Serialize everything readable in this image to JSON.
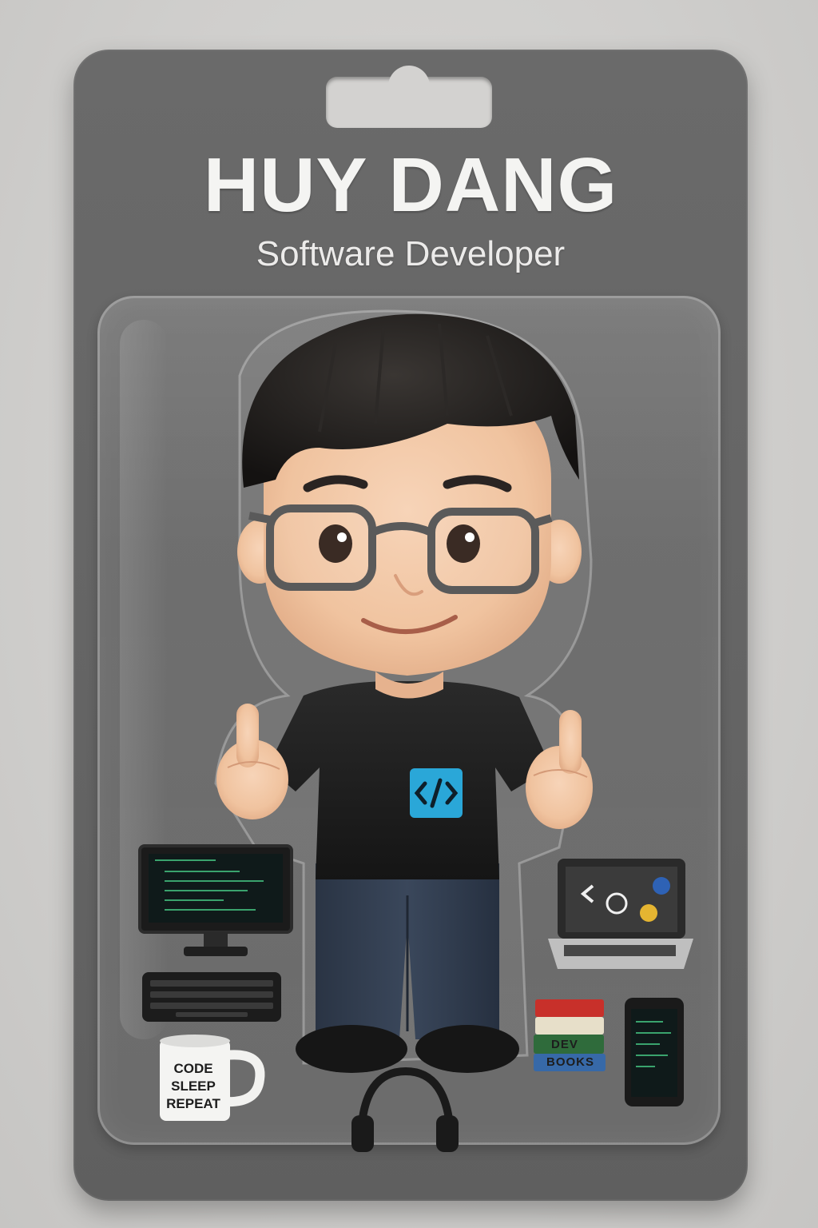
{
  "card": {
    "name": "HUY DANG",
    "role": "Software Developer"
  },
  "figure": {
    "shirt_icon": "code-brackets-icon",
    "shirt_icon_text": "</>",
    "pose": "double thumbs up"
  },
  "accessories": {
    "mug_lines": [
      "CODE",
      "SLEEP",
      "REPEAT"
    ],
    "books_lines": [
      "DEV",
      "BOOKS"
    ],
    "items": [
      "monitor",
      "keyboard",
      "laptop",
      "phone",
      "headphones",
      "mug",
      "books"
    ]
  },
  "colors": {
    "card": "#656565",
    "background": "#d3d2d0",
    "shirt": "#1e1e1e",
    "jeans": "#2f3a4a",
    "shirt_icon": "#2aa7d8",
    "hair": "#1c1a19",
    "skin": "#f2c7a6"
  }
}
